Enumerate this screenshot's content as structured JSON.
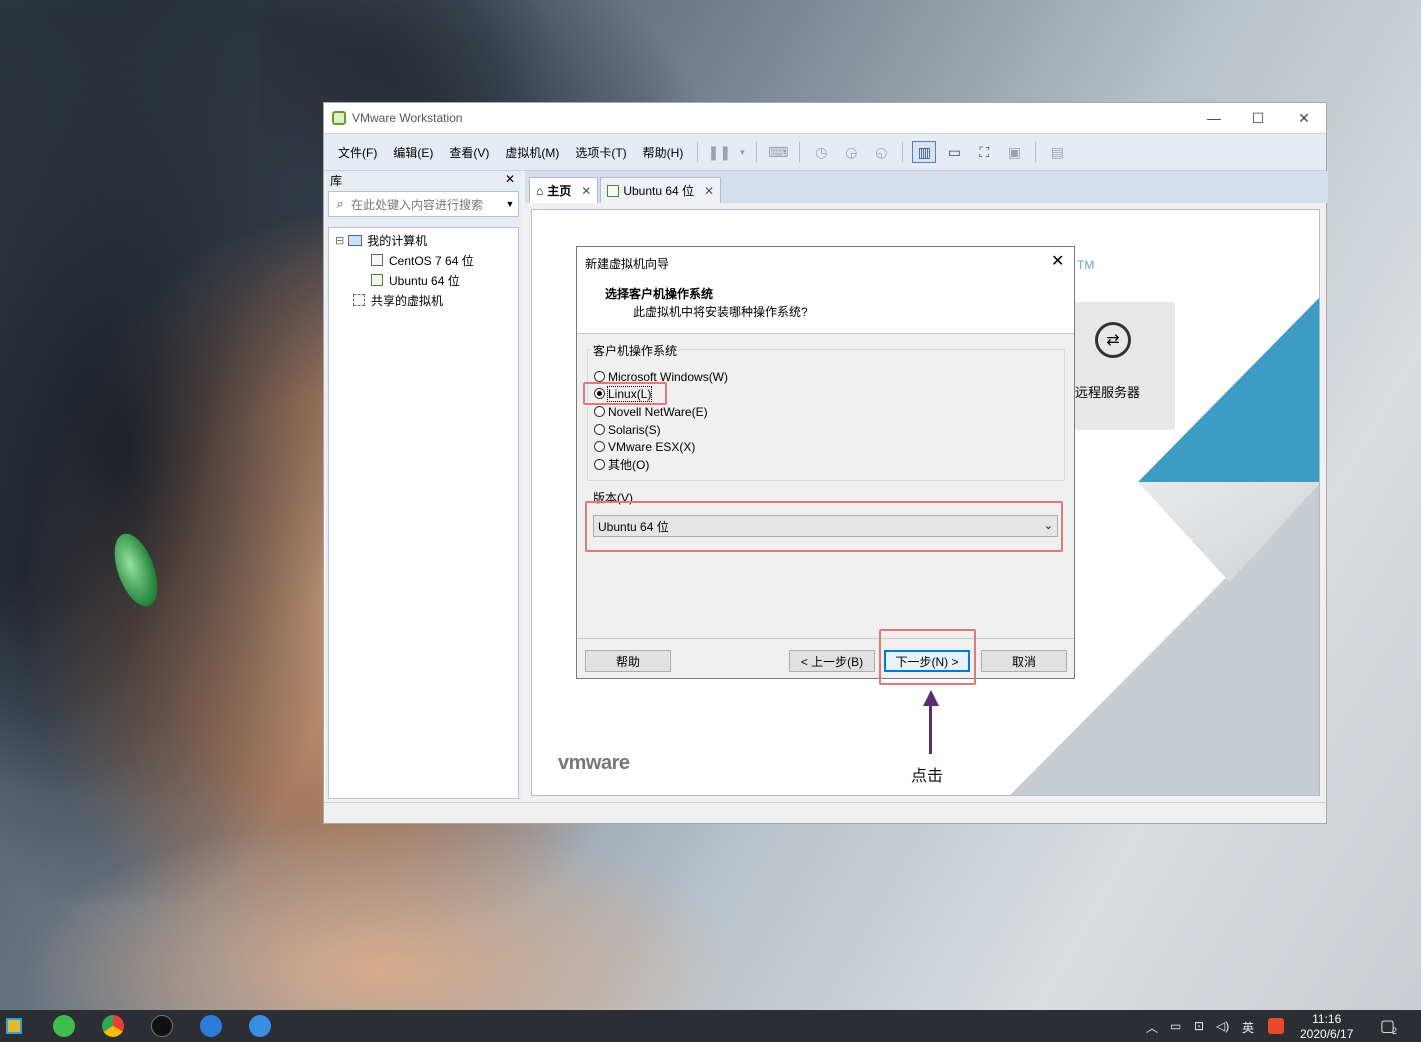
{
  "window": {
    "title": "VMware Workstation",
    "controls": {
      "minimize": "—",
      "maximize": "☐",
      "close": "✕"
    }
  },
  "menu": [
    "文件(F)",
    "编辑(E)",
    "查看(V)",
    "虚拟机(M)",
    "选项卡(T)",
    "帮助(H)"
  ],
  "library": {
    "title": "库",
    "close": "✕",
    "search_placeholder": "在此处键入内容进行搜索",
    "tree": {
      "my_computer": "我的计算机",
      "vms": [
        "CentOS 7 64 位",
        "Ubuntu 64 位"
      ],
      "shared": "共享的虚拟机",
      "expander": "⊟"
    }
  },
  "tabs": [
    {
      "label": "主页",
      "close": "✕"
    },
    {
      "label": "Ubuntu 64 位",
      "close": "✕"
    }
  ],
  "home": {
    "tm": "TM",
    "remote_label": "远程服务器",
    "logo": "vmware"
  },
  "wizard": {
    "title": "新建虚拟机向导",
    "close": "✕",
    "heading": "选择客户机操作系统",
    "subheading": "此虚拟机中将安装哪种操作系统?",
    "group_label": "客户机操作系统",
    "os_options": [
      "Microsoft Windows(W)",
      "Linux(L)",
      "Novell NetWare(E)",
      "Solaris(S)",
      "VMware ESX(X)",
      "其他(O)"
    ],
    "selected_os": "Linux(L)",
    "version_label": "版本(V)",
    "version_value": "Ubuntu 64 位",
    "buttons": {
      "help": "帮助",
      "back": "< 上一步(B)",
      "next": "下一步(N) >",
      "cancel": "取消"
    }
  },
  "annotation": {
    "click_label": "点击"
  },
  "taskbar": {
    "time": "11:16",
    "date": "2020/6/17",
    "ime": "英",
    "notification_count": "2"
  },
  "colors": {
    "highlight": "#e07a7a",
    "arrow": "#5a2d6e",
    "accent": "#0078d7"
  }
}
